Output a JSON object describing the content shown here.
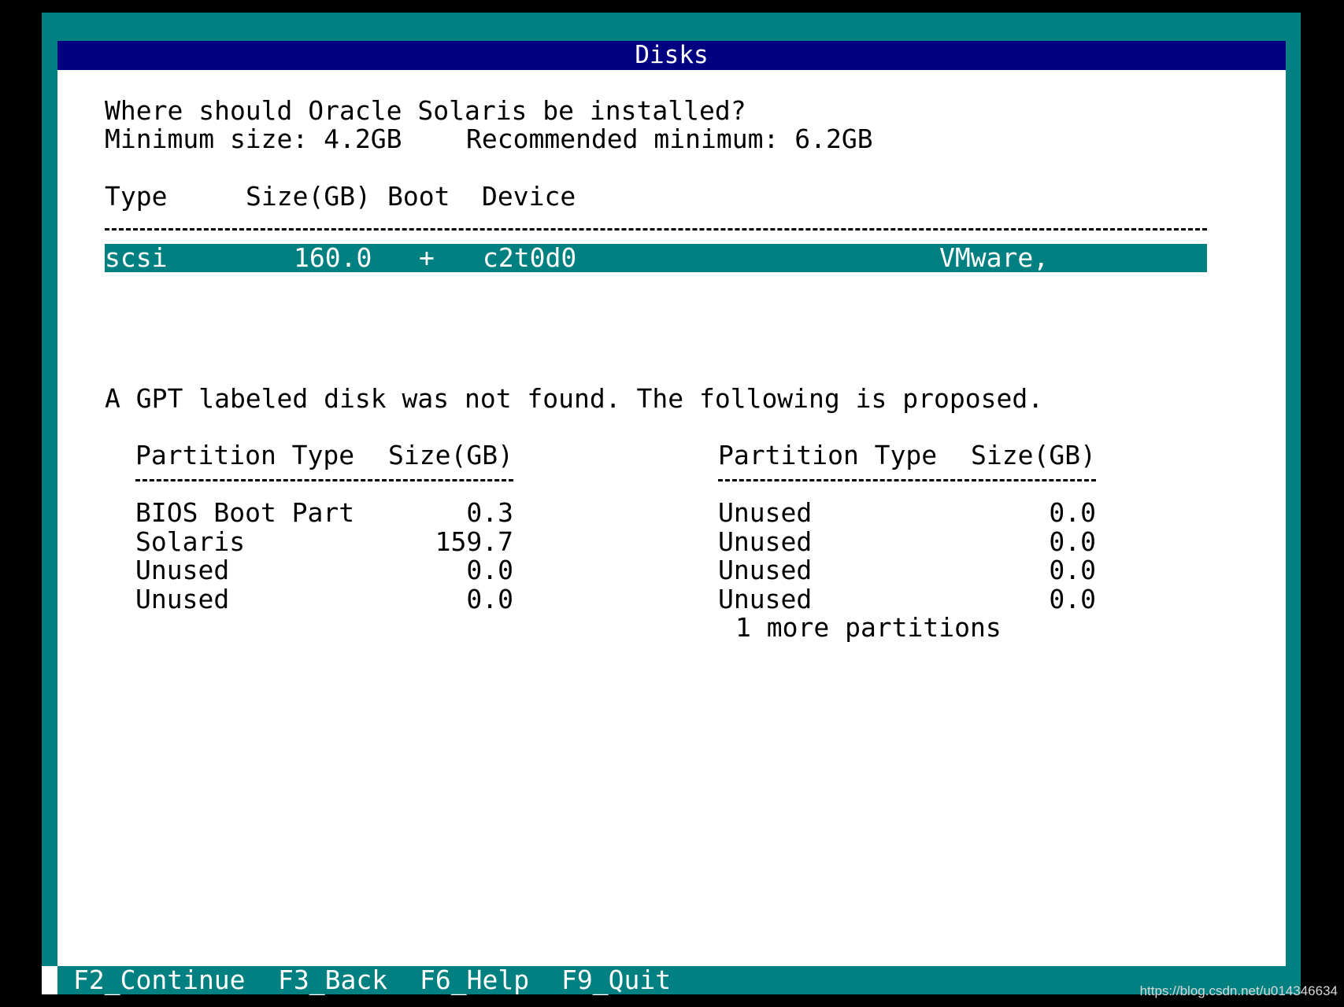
{
  "window": {
    "title": "Disks"
  },
  "prompt": {
    "question": "Where should Oracle Solaris be installed?",
    "minimum_size": "Minimum size: 4.2GB",
    "recommended_minimum": "Recommended minimum: 6.2GB"
  },
  "disk_table": {
    "headers": {
      "type": "Type",
      "size": "Size(GB)",
      "boot": "Boot",
      "device": "Device"
    },
    "rows": [
      {
        "type": "scsi",
        "size": "160.0",
        "boot": "+",
        "device": "c2t0d0",
        "vendor": "VMware,",
        "selected": true
      }
    ]
  },
  "notice": "A GPT labeled disk was not found. The following is proposed.",
  "partitions": {
    "header_type": "Partition Type",
    "header_size": "Size(GB)",
    "left": [
      {
        "type": "BIOS Boot Part",
        "size": "0.3"
      },
      {
        "type": "Solaris",
        "size": "159.7"
      },
      {
        "type": "Unused",
        "size": "0.0"
      },
      {
        "type": "Unused",
        "size": "0.0"
      }
    ],
    "right": [
      {
        "type": "Unused",
        "size": "0.0"
      },
      {
        "type": "Unused",
        "size": "0.0"
      },
      {
        "type": "Unused",
        "size": "0.0"
      },
      {
        "type": "Unused",
        "size": "0.0"
      }
    ],
    "more": "1 more partitions"
  },
  "footer": {
    "keys": [
      {
        "label": "F2_Continue"
      },
      {
        "label": "F3_Back"
      },
      {
        "label": "F6_Help"
      },
      {
        "label": "F9_Quit"
      }
    ]
  },
  "watermark": "https://blog.csdn.net/u014346634",
  "colors": {
    "background": "#000000",
    "teal": "#008080",
    "title_bar": "#000080",
    "panel": "#ffffff"
  }
}
